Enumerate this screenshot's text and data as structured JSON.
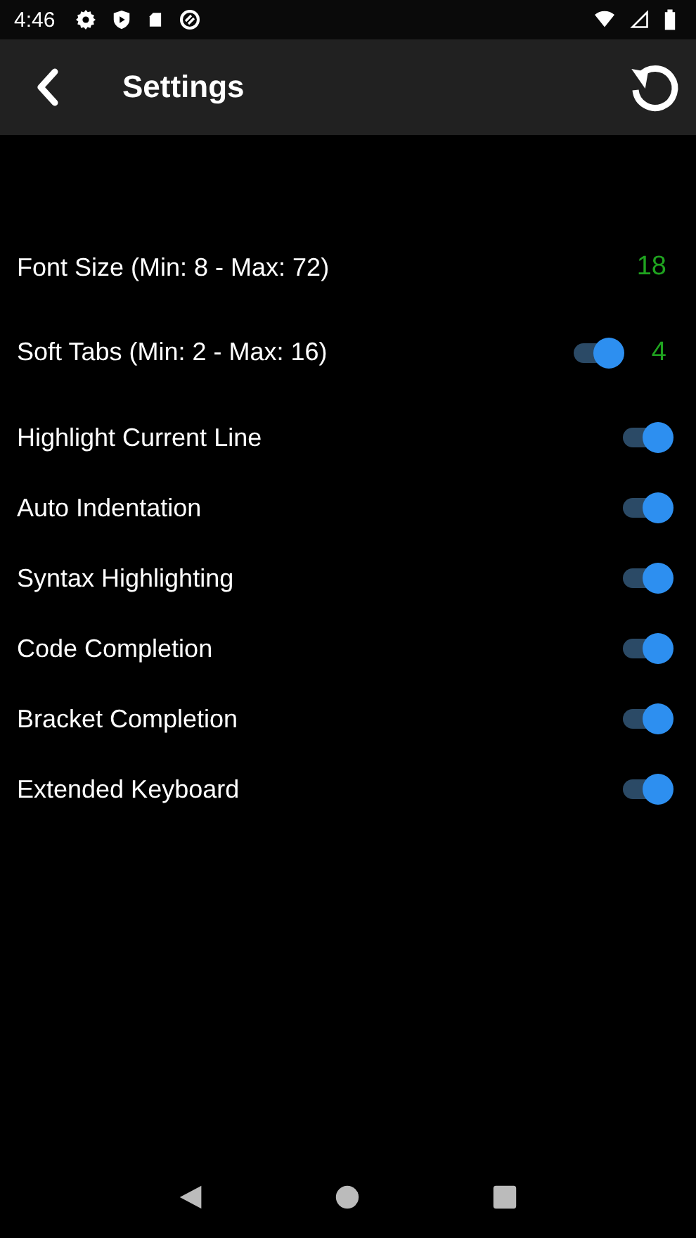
{
  "status_bar": {
    "time": "4:46"
  },
  "app_bar": {
    "title": "Settings"
  },
  "settings": [
    {
      "kind": "number",
      "label": "Font Size (Min: 8 - Max: 72)",
      "value": "18"
    },
    {
      "kind": "switch-number",
      "label": "Soft Tabs (Min: 2 - Max: 16)",
      "on": true,
      "value": "4"
    },
    {
      "kind": "switch",
      "label": "Highlight Current Line",
      "on": true
    },
    {
      "kind": "switch",
      "label": "Auto Indentation",
      "on": true
    },
    {
      "kind": "switch",
      "label": "Syntax Highlighting",
      "on": true
    },
    {
      "kind": "switch",
      "label": "Code Completion",
      "on": true
    },
    {
      "kind": "switch",
      "label": "Bracket Completion",
      "on": true
    },
    {
      "kind": "switch",
      "label": "Extended Keyboard",
      "on": true
    }
  ]
}
